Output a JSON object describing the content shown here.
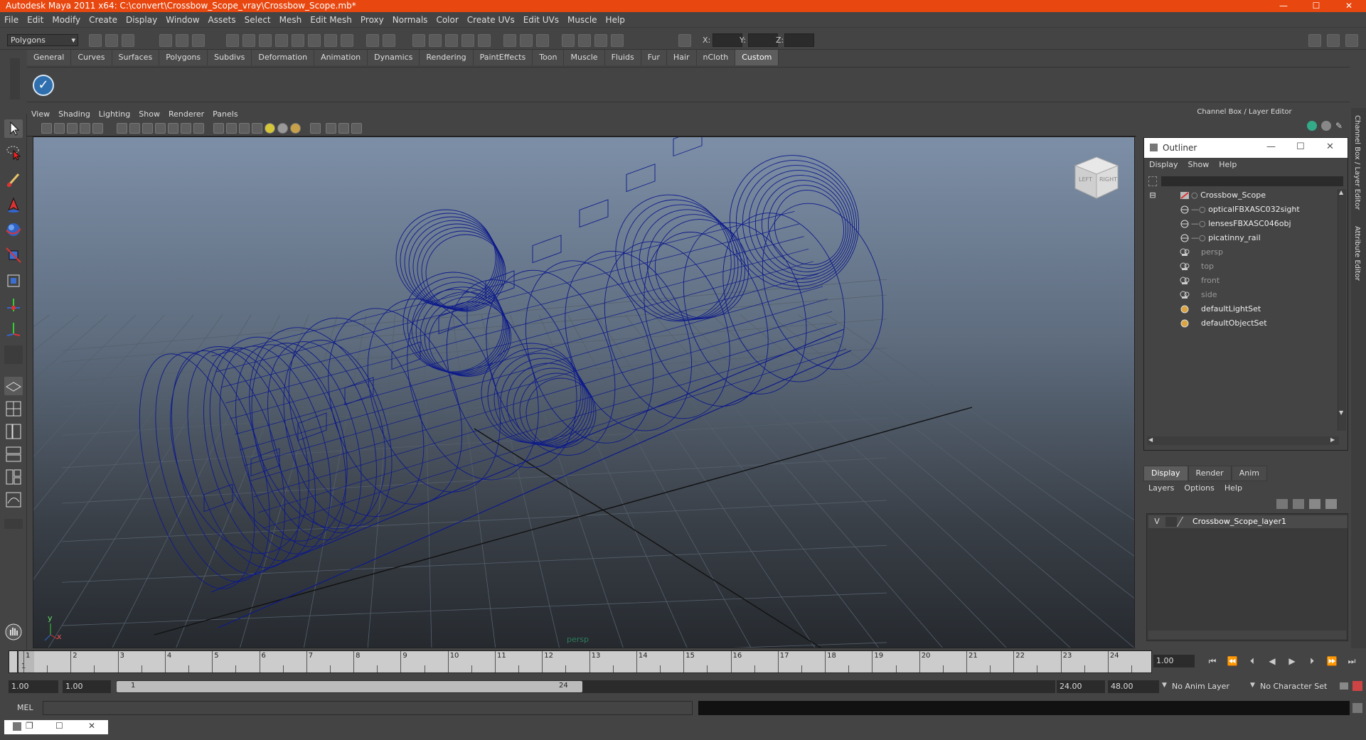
{
  "window": {
    "title": "Autodesk Maya 2011 x64: C:\\convert\\Crossbow_Scope_vray\\Crossbow_Scope.mb*",
    "controls": [
      "—",
      "☐",
      "✕"
    ]
  },
  "menubar": [
    "File",
    "Edit",
    "Modify",
    "Create",
    "Display",
    "Window",
    "Assets",
    "Select",
    "Mesh",
    "Edit Mesh",
    "Proxy",
    "Normals",
    "Color",
    "Create UVs",
    "Edit UVs",
    "Muscle",
    "Help"
  ],
  "statusline": {
    "mode": "Polygons",
    "x_label": "X:",
    "y_label": "Y:",
    "z_label": "Z:"
  },
  "shelf": {
    "tabs": [
      "General",
      "Curves",
      "Surfaces",
      "Polygons",
      "Subdivs",
      "Deformation",
      "Animation",
      "Dynamics",
      "Rendering",
      "PaintEffects",
      "Toon",
      "Muscle",
      "Fluids",
      "Fur",
      "Hair",
      "nCloth",
      "Custom"
    ],
    "active_tab": "Custom"
  },
  "viewport": {
    "menu": [
      "View",
      "Shading",
      "Lighting",
      "Show",
      "Renderer",
      "Panels"
    ],
    "camera_label": "persp",
    "viewcube_left": "LEFT",
    "viewcube_right": "RIGHT",
    "axis_y": "y",
    "axis_x": "x",
    "wire_color": "#0d1a8a"
  },
  "channel_box": {
    "header": "Channel Box / Layer Editor"
  },
  "outliner": {
    "title": "Outliner",
    "menu": [
      "Display",
      "Show",
      "Help"
    ],
    "items": [
      {
        "label": "Crossbow_Scope",
        "dim": false
      },
      {
        "label": "opticalFBXASC032sight",
        "dim": false
      },
      {
        "label": "lensesFBXASC046obj",
        "dim": false
      },
      {
        "label": "picatinny_rail",
        "dim": false
      },
      {
        "label": "persp",
        "dim": true
      },
      {
        "label": "top",
        "dim": true
      },
      {
        "label": "front",
        "dim": true
      },
      {
        "label": "side",
        "dim": true
      },
      {
        "label": "defaultLightSet",
        "dim": false
      },
      {
        "label": "defaultObjectSet",
        "dim": false
      }
    ]
  },
  "layer_editor": {
    "tabs": [
      "Display",
      "Render",
      "Anim"
    ],
    "active_tab": "Display",
    "menu": [
      "Layers",
      "Options",
      "Help"
    ],
    "layer": {
      "visible": "V",
      "name": "Crossbow_Scope_layer1"
    }
  },
  "side_tabs": [
    "Channel Box / Layer Editor",
    "Attribute Editor"
  ],
  "time_slider": {
    "frames": [
      "1",
      "2",
      "3",
      "4",
      "5",
      "6",
      "7",
      "8",
      "9",
      "10",
      "11",
      "12",
      "13",
      "14",
      "15",
      "16",
      "17",
      "18",
      "19",
      "20",
      "21",
      "22",
      "23",
      "24"
    ],
    "current_frame": "1",
    "current_field": "1.00"
  },
  "range": {
    "start": "1.00",
    "playback_start": "1.00",
    "handle_start": "1",
    "handle_end": "24",
    "playback_end": "24.00",
    "end": "48.00",
    "anim_layer": "No Anim Layer",
    "character_set": "No Character Set"
  },
  "command_line": {
    "label": "MEL"
  }
}
